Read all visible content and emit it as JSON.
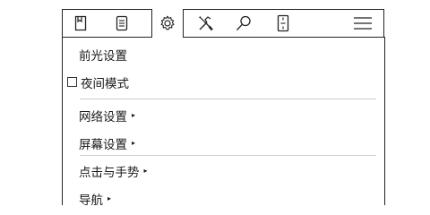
{
  "toolbar": {
    "tabs": [
      {
        "icon": "bookmark-icon"
      },
      {
        "icon": "document-icon"
      },
      {
        "icon": "gear-icon",
        "active": true
      },
      {
        "icon": "tools-icon"
      },
      {
        "icon": "search-icon"
      },
      {
        "icon": "page-icon"
      },
      {
        "icon": "hamburger-menu-icon"
      }
    ]
  },
  "menu": {
    "items": [
      {
        "label": "前光设置",
        "has_submenu": false
      },
      {
        "label": "夜间模式",
        "checkbox": true,
        "checked": false
      },
      {
        "label": "网络设置",
        "has_submenu": true
      },
      {
        "label": "屏幕设置",
        "has_submenu": true
      },
      {
        "label": "点击与手势",
        "has_submenu": true
      },
      {
        "label": "导航",
        "has_submenu": true
      }
    ],
    "submenu_arrow": "▸"
  }
}
